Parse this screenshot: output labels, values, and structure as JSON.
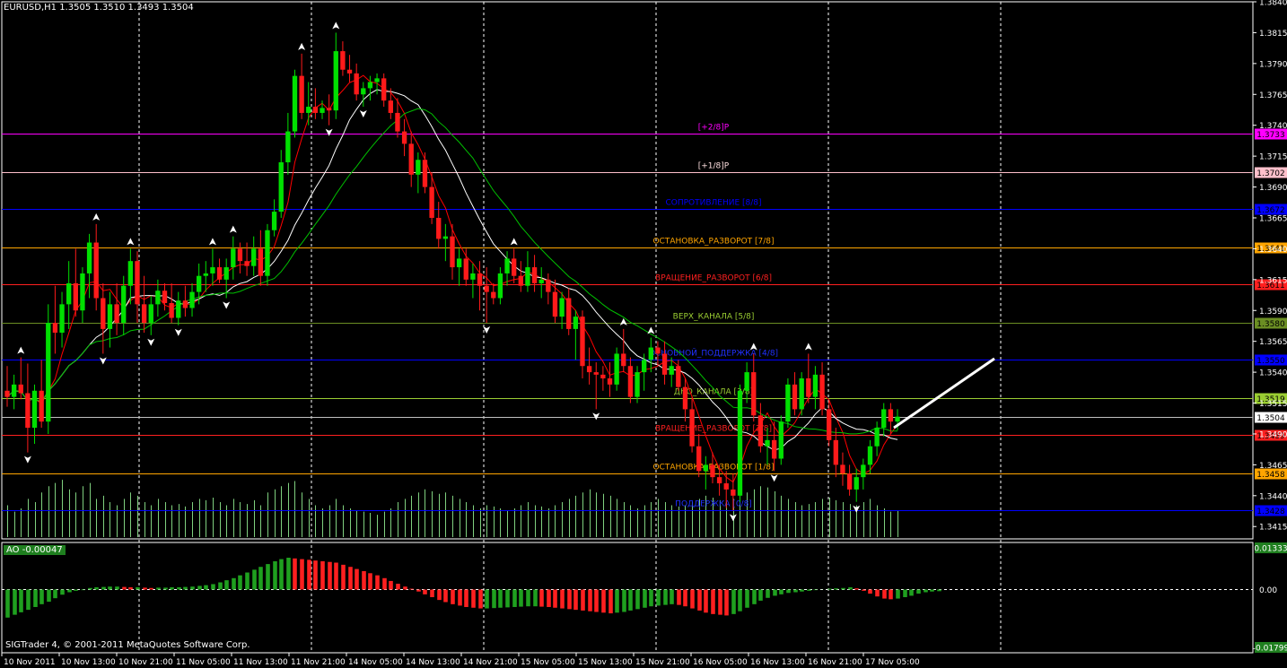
{
  "header": {
    "symbol_line": "EURUSD,H1  1.3505 1.3510 1.3493 1.3504"
  },
  "indicator_header": {
    "label": "AO -0.00047"
  },
  "footer": {
    "copyright": "SIGTrader 4, © 2001-2011 MetaQuotes Software Corp."
  },
  "colors": {
    "bull": "#00e000",
    "bear": "#ff1a1a",
    "ma_red": "#ff0000",
    "ma_white": "#ffffff",
    "ma_green": "#00c000",
    "volume": "#7fd07f",
    "grid": "#ffffff",
    "axis": "#ffffff"
  },
  "chart_data": {
    "type": "candlestick",
    "symbol": "EURUSD",
    "timeframe": "H1",
    "ylim": [
      1.3405,
      1.384
    ],
    "y_ticks": [
      "1.3840",
      "1.3815",
      "1.3790",
      "1.3765",
      "1.3740",
      "1.3715",
      "1.3690",
      "1.3665",
      "1.3640",
      "1.3615",
      "1.3590",
      "1.3565",
      "1.3540",
      "1.3515",
      "1.3490",
      "1.3465",
      "1.3440",
      "1.3415"
    ],
    "x_ticks": [
      "10 Nov 2011",
      "10 Nov 13:00",
      "10 Nov 21:00",
      "11 Nov 05:00",
      "11 Nov 13:00",
      "11 Nov 21:00",
      "14 Nov 05:00",
      "14 Nov 13:00",
      "14 Nov 21:00",
      "15 Nov 05:00",
      "15 Nov 13:00",
      "15 Nov 21:00",
      "16 Nov 05:00",
      "16 Nov 13:00",
      "16 Nov 21:00",
      "17 Nov 05:00"
    ],
    "current_price": "1.3504",
    "levels": [
      {
        "label": "[+2/8]P",
        "price": 1.3733,
        "price_label": "1.3733",
        "color": "#ff00ff",
        "text_color": "#ff00ff"
      },
      {
        "label": "[+1/8]P",
        "price": 1.3702,
        "price_label": "1.3702",
        "color": "#ffc0cb",
        "text_color": "#ffe0e0"
      },
      {
        "label": "СОПРОТИВЛЕНИЕ [8/8]",
        "price": 1.3672,
        "price_label": "1.3672",
        "color": "#0000ff",
        "text_color": "#0000ff"
      },
      {
        "label": "ОСТАНОВКА_РАЗВОРОТ [7/8]",
        "price": 1.3641,
        "price_label": "1.3641",
        "color": "#ffa500",
        "text_color": "#ffa500"
      },
      {
        "label": "ВРАЩЕНИЕ_РАЗВОРОТ [6/8]",
        "price": 1.3611,
        "price_label": "1.3611",
        "color": "#ff2020",
        "text_color": "#ff2020"
      },
      {
        "label": "ВЕРХ_КАНАЛА [5/8]",
        "price": 1.358,
        "price_label": "1.3580",
        "color": "#6b8e23",
        "text_color": "#9acd32"
      },
      {
        "label": "ОСНОВНОЙ_ПОДДЕРЖКА [4/8]",
        "price": 1.355,
        "price_label": "1.3550",
        "color": "#0000ff",
        "text_color": "#2030ff"
      },
      {
        "label": "ДНО_КАНАЛА [3/8]",
        "price": 1.3519,
        "price_label": "1.3519",
        "color": "#9acd32",
        "text_color": "#9acd32"
      },
      {
        "label": "ВРАЩЕНИЕ_РАЗВОРОТ [2/8]",
        "price": 1.3489,
        "price_label": "1.3489",
        "color": "#ff2020",
        "text_color": "#ff2020"
      },
      {
        "label": "ОСТАНОВКА_РАЗВОРОТ [1/8]",
        "price": 1.3458,
        "price_label": "1.3458",
        "color": "#ffa500",
        "text_color": "#ffa500"
      },
      {
        "label": "ПОДДЕРЖКА [0/8]",
        "price": 1.3428,
        "price_label": "1.3428",
        "color": "#0000ff",
        "text_color": "#2030ff"
      }
    ],
    "candles": [
      [
        1.3525,
        1.3545,
        1.3512,
        1.352
      ],
      [
        1.352,
        1.3538,
        1.351,
        1.353
      ],
      [
        1.353,
        1.3552,
        1.3518,
        1.3523
      ],
      [
        1.3523,
        1.3547,
        1.3475,
        1.3495
      ],
      [
        1.3495,
        1.353,
        1.3482,
        1.3525
      ],
      [
        1.3525,
        1.355,
        1.3495,
        1.35
      ],
      [
        1.35,
        1.3595,
        1.349,
        1.358
      ],
      [
        1.358,
        1.361,
        1.3555,
        1.3572
      ],
      [
        1.3572,
        1.3605,
        1.356,
        1.3595
      ],
      [
        1.3595,
        1.363,
        1.3575,
        1.3612
      ],
      [
        1.3612,
        1.364,
        1.3585,
        1.359
      ],
      [
        1.359,
        1.3625,
        1.358,
        1.362
      ],
      [
        1.362,
        1.3652,
        1.36,
        1.3645
      ],
      [
        1.3645,
        1.366,
        1.359,
        1.36
      ],
      [
        1.36,
        1.3612,
        1.3555,
        1.3575
      ],
      [
        1.3575,
        1.3605,
        1.356,
        1.3595
      ],
      [
        1.3595,
        1.3612,
        1.357,
        1.358
      ],
      [
        1.358,
        1.3618,
        1.357,
        1.361
      ],
      [
        1.361,
        1.364,
        1.3595,
        1.363
      ],
      [
        1.363,
        1.3638,
        1.358,
        1.3595
      ],
      [
        1.3595,
        1.3618,
        1.3572,
        1.358
      ],
      [
        1.358,
        1.3602,
        1.357,
        1.3595
      ],
      [
        1.3595,
        1.3615,
        1.3585,
        1.3606
      ],
      [
        1.3606,
        1.3612,
        1.359,
        1.3596
      ],
      [
        1.3596,
        1.3612,
        1.358,
        1.3584
      ],
      [
        1.3584,
        1.3605,
        1.3578,
        1.3598
      ],
      [
        1.3598,
        1.361,
        1.3585,
        1.3592
      ],
      [
        1.3592,
        1.3612,
        1.3585,
        1.3605
      ],
      [
        1.3605,
        1.3628,
        1.3595,
        1.3618
      ],
      [
        1.3618,
        1.363,
        1.3605,
        1.362
      ],
      [
        1.362,
        1.364,
        1.361,
        1.3625
      ],
      [
        1.3625,
        1.3632,
        1.3612,
        1.3615
      ],
      [
        1.3615,
        1.3632,
        1.36,
        1.3625
      ],
      [
        1.3625,
        1.365,
        1.3615,
        1.364
      ],
      [
        1.364,
        1.3645,
        1.362,
        1.363
      ],
      [
        1.363,
        1.3645,
        1.3618,
        1.3626
      ],
      [
        1.3626,
        1.365,
        1.3618,
        1.364
      ],
      [
        1.364,
        1.3655,
        1.361,
        1.3618
      ],
      [
        1.3618,
        1.366,
        1.361,
        1.3655
      ],
      [
        1.3655,
        1.368,
        1.365,
        1.367
      ],
      [
        1.367,
        1.372,
        1.3665,
        1.371
      ],
      [
        1.371,
        1.375,
        1.37,
        1.3735
      ],
      [
        1.3735,
        1.3785,
        1.373,
        1.378
      ],
      [
        1.378,
        1.3798,
        1.3745,
        1.375
      ],
      [
        1.375,
        1.3775,
        1.374,
        1.3755
      ],
      [
        1.3755,
        1.377,
        1.3745,
        1.375
      ],
      [
        1.375,
        1.376,
        1.3745,
        1.3754
      ],
      [
        1.3754,
        1.3765,
        1.374,
        1.3752
      ],
      [
        1.3752,
        1.3815,
        1.3745,
        1.38
      ],
      [
        1.38,
        1.3808,
        1.378,
        1.3785
      ],
      [
        1.3785,
        1.3797,
        1.3775,
        1.3782
      ],
      [
        1.3782,
        1.379,
        1.376,
        1.3765
      ],
      [
        1.3765,
        1.3775,
        1.3755,
        1.377
      ],
      [
        1.377,
        1.378,
        1.376,
        1.3775
      ],
      [
        1.3775,
        1.3782,
        1.3765,
        1.3778
      ],
      [
        1.3778,
        1.3782,
        1.3755,
        1.376
      ],
      [
        1.376,
        1.377,
        1.3745,
        1.375
      ],
      [
        1.375,
        1.3762,
        1.373,
        1.3735
      ],
      [
        1.3735,
        1.3745,
        1.3715,
        1.3725
      ],
      [
        1.3725,
        1.3735,
        1.369,
        1.37
      ],
      [
        1.37,
        1.3718,
        1.3685,
        1.3712
      ],
      [
        1.3712,
        1.3718,
        1.3685,
        1.369
      ],
      [
        1.369,
        1.3702,
        1.366,
        1.3665
      ],
      [
        1.3665,
        1.3678,
        1.364,
        1.3648
      ],
      [
        1.3648,
        1.366,
        1.363,
        1.365
      ],
      [
        1.365,
        1.366,
        1.3615,
        1.3625
      ],
      [
        1.3625,
        1.364,
        1.361,
        1.3632
      ],
      [
        1.3632,
        1.364,
        1.361,
        1.3615
      ],
      [
        1.3615,
        1.3628,
        1.36,
        1.362
      ],
      [
        1.362,
        1.363,
        1.359,
        1.361
      ],
      [
        1.361,
        1.3625,
        1.358,
        1.3605
      ],
      [
        1.3605,
        1.3612,
        1.3595,
        1.36
      ],
      [
        1.36,
        1.3625,
        1.3595,
        1.362
      ],
      [
        1.362,
        1.3638,
        1.361,
        1.3632
      ],
      [
        1.3632,
        1.364,
        1.3612,
        1.3618
      ],
      [
        1.3618,
        1.363,
        1.3605,
        1.361
      ],
      [
        1.361,
        1.3638,
        1.3605,
        1.3625
      ],
      [
        1.3625,
        1.3635,
        1.3605,
        1.3612
      ],
      [
        1.3612,
        1.3625,
        1.36,
        1.3615
      ],
      [
        1.3615,
        1.362,
        1.3595,
        1.3605
      ],
      [
        1.3605,
        1.3615,
        1.358,
        1.3585
      ],
      [
        1.3585,
        1.3605,
        1.3575,
        1.36
      ],
      [
        1.36,
        1.3608,
        1.357,
        1.3575
      ],
      [
        1.3575,
        1.359,
        1.355,
        1.3585
      ],
      [
        1.3585,
        1.359,
        1.3535,
        1.3545
      ],
      [
        1.3545,
        1.356,
        1.353,
        1.354
      ],
      [
        1.354,
        1.3548,
        1.351,
        1.3538
      ],
      [
        1.3538,
        1.3545,
        1.3525,
        1.3535
      ],
      [
        1.3535,
        1.3548,
        1.352,
        1.353
      ],
      [
        1.353,
        1.356,
        1.3525,
        1.3555
      ],
      [
        1.3555,
        1.3575,
        1.354,
        1.3545
      ],
      [
        1.3545,
        1.3552,
        1.3515,
        1.352
      ],
      [
        1.352,
        1.3545,
        1.3515,
        1.354
      ],
      [
        1.354,
        1.3555,
        1.3525,
        1.355
      ],
      [
        1.355,
        1.3568,
        1.354,
        1.356
      ],
      [
        1.356,
        1.3565,
        1.3545,
        1.3555
      ],
      [
        1.3555,
        1.3565,
        1.353,
        1.3538
      ],
      [
        1.3538,
        1.3552,
        1.3528,
        1.3545
      ],
      [
        1.3545,
        1.355,
        1.3525,
        1.3528
      ],
      [
        1.3528,
        1.3535,
        1.35,
        1.351
      ],
      [
        1.351,
        1.352,
        1.3475,
        1.348
      ],
      [
        1.348,
        1.349,
        1.3455,
        1.346
      ],
      [
        1.346,
        1.3472,
        1.3445,
        1.3465
      ],
      [
        1.3465,
        1.3475,
        1.345,
        1.3455
      ],
      [
        1.3455,
        1.3465,
        1.344,
        1.345
      ],
      [
        1.345,
        1.346,
        1.343,
        1.3445
      ],
      [
        1.3445,
        1.3458,
        1.3428,
        1.344
      ],
      [
        1.344,
        1.353,
        1.3435,
        1.3525
      ],
      [
        1.3525,
        1.3548,
        1.3515,
        1.354
      ],
      [
        1.354,
        1.3555,
        1.35,
        1.3505
      ],
      [
        1.3505,
        1.3515,
        1.3475,
        1.348
      ],
      [
        1.348,
        1.3495,
        1.3465,
        1.3485
      ],
      [
        1.3485,
        1.35,
        1.346,
        1.347
      ],
      [
        1.347,
        1.3505,
        1.3465,
        1.35
      ],
      [
        1.35,
        1.3535,
        1.3495,
        1.353
      ],
      [
        1.353,
        1.354,
        1.3505,
        1.351
      ],
      [
        1.351,
        1.354,
        1.3505,
        1.3535
      ],
      [
        1.3535,
        1.3555,
        1.3515,
        1.352
      ],
      [
        1.352,
        1.3545,
        1.351,
        1.3538
      ],
      [
        1.3538,
        1.3548,
        1.3505,
        1.351
      ],
      [
        1.351,
        1.3518,
        1.348,
        1.3485
      ],
      [
        1.3485,
        1.3495,
        1.3455,
        1.3465
      ],
      [
        1.3465,
        1.3475,
        1.3448,
        1.3458
      ],
      [
        1.3458,
        1.3465,
        1.344,
        1.3445
      ],
      [
        1.3445,
        1.3462,
        1.3435,
        1.3455
      ],
      [
        1.3455,
        1.347,
        1.3445,
        1.3465
      ],
      [
        1.3465,
        1.3485,
        1.3458,
        1.348
      ],
      [
        1.348,
        1.35,
        1.3472,
        1.3495
      ],
      [
        1.3495,
        1.3515,
        1.3488,
        1.351
      ],
      [
        1.351,
        1.3515,
        1.349,
        1.35
      ],
      [
        1.35,
        1.351,
        1.3493,
        1.3504
      ]
    ],
    "volume_ratio": [
      0.5,
      0.4,
      0.45,
      0.6,
      0.55,
      0.7,
      0.8,
      0.85,
      0.9,
      0.75,
      0.7,
      0.8,
      0.85,
      0.6,
      0.65,
      0.55,
      0.5,
      0.6,
      0.7,
      0.65,
      0.55,
      0.5,
      0.6,
      0.55,
      0.5,
      0.52,
      0.48,
      0.55,
      0.6,
      0.58,
      0.62,
      0.55,
      0.5,
      0.6,
      0.55,
      0.52,
      0.58,
      0.5,
      0.7,
      0.75,
      0.8,
      0.85,
      0.88,
      0.7,
      0.6,
      0.5,
      0.45,
      0.5,
      0.6,
      0.5,
      0.45,
      0.42,
      0.4,
      0.38,
      0.35,
      0.4,
      0.45,
      0.55,
      0.6,
      0.65,
      0.7,
      0.75,
      0.72,
      0.68,
      0.7,
      0.65,
      0.6,
      0.55,
      0.5,
      0.45,
      0.5,
      0.48,
      0.45,
      0.42,
      0.45,
      0.5,
      0.55,
      0.5,
      0.48,
      0.45,
      0.5,
      0.55,
      0.6,
      0.65,
      0.7,
      0.75,
      0.7,
      0.68,
      0.65,
      0.6,
      0.55,
      0.5,
      0.45,
      0.5,
      0.55,
      0.6,
      0.55,
      0.5,
      0.48,
      0.5,
      0.55,
      0.6,
      0.65,
      0.62,
      0.58,
      0.55,
      0.6,
      0.65,
      0.7,
      0.75,
      0.8,
      0.78,
      0.72,
      0.65,
      0.6,
      0.55,
      0.5,
      0.52,
      0.55,
      0.6,
      0.62,
      0.58,
      0.55,
      0.52,
      0.5,
      0.55,
      0.6,
      0.5,
      0.45,
      0.4,
      0.42,
      0.48,
      0.45,
      0.4,
      0.35,
      0.3
    ],
    "ao": {
      "label": "AO -0.00047",
      "ylim": [
        -0.01799,
        0.01333
      ],
      "y_ticks": [
        "0.01333",
        "0.00",
        "-0.01799"
      ],
      "values": [
        -0.008,
        -0.0072,
        -0.0065,
        -0.0058,
        -0.005,
        -0.0042,
        -0.0035,
        -0.0025,
        -0.0015,
        -0.0008,
        -0.0004,
        -0.0002,
        0.0004,
        0.0006,
        0.0007,
        0.0008,
        0.0008,
        0.0007,
        0.0006,
        0.0006,
        0.0005,
        0.0004,
        0.0005,
        0.0005,
        0.0006,
        0.0006,
        0.0007,
        0.0008,
        0.001,
        0.0012,
        0.0015,
        0.002,
        0.0026,
        0.0032,
        0.004,
        0.0048,
        0.0056,
        0.0064,
        0.0072,
        0.008,
        0.0086,
        0.009,
        0.0088,
        0.0086,
        0.0084,
        0.0082,
        0.008,
        0.0078,
        0.0076,
        0.007,
        0.0064,
        0.0058,
        0.0052,
        0.0046,
        0.004,
        0.0032,
        0.0024,
        0.0016,
        0.0008,
        0.0002,
        -0.0006,
        -0.0014,
        -0.0022,
        -0.003,
        -0.0036,
        -0.0042,
        -0.0046,
        -0.005,
        -0.0052,
        -0.0054,
        -0.0054,
        -0.0053,
        -0.0052,
        -0.0051,
        -0.005,
        -0.0049,
        -0.0048,
        -0.0048,
        -0.0049,
        -0.005,
        -0.0052,
        -0.0054,
        -0.0056,
        -0.0058,
        -0.006,
        -0.0062,
        -0.0064,
        -0.0066,
        -0.0068,
        -0.0066,
        -0.0064,
        -0.006,
        -0.0056,
        -0.0052,
        -0.0048,
        -0.0046,
        -0.0044,
        -0.0042,
        -0.0044,
        -0.0048,
        -0.0054,
        -0.006,
        -0.0066,
        -0.007,
        -0.0072,
        -0.0074,
        -0.007,
        -0.0062,
        -0.0052,
        -0.0042,
        -0.0032,
        -0.0024,
        -0.0018,
        -0.0014,
        -0.001,
        -0.0008,
        -0.0006,
        -0.0004,
        -0.0002,
        0.0,
        0.0002,
        0.0003,
        0.0004,
        0.0006,
        0.0003,
        -0.0004,
        -0.0012,
        -0.002,
        -0.0026,
        -0.0028,
        -0.0026,
        -0.0022,
        -0.0018,
        -0.0012,
        -0.0008,
        -0.0006,
        -0.0005
      ]
    }
  }
}
